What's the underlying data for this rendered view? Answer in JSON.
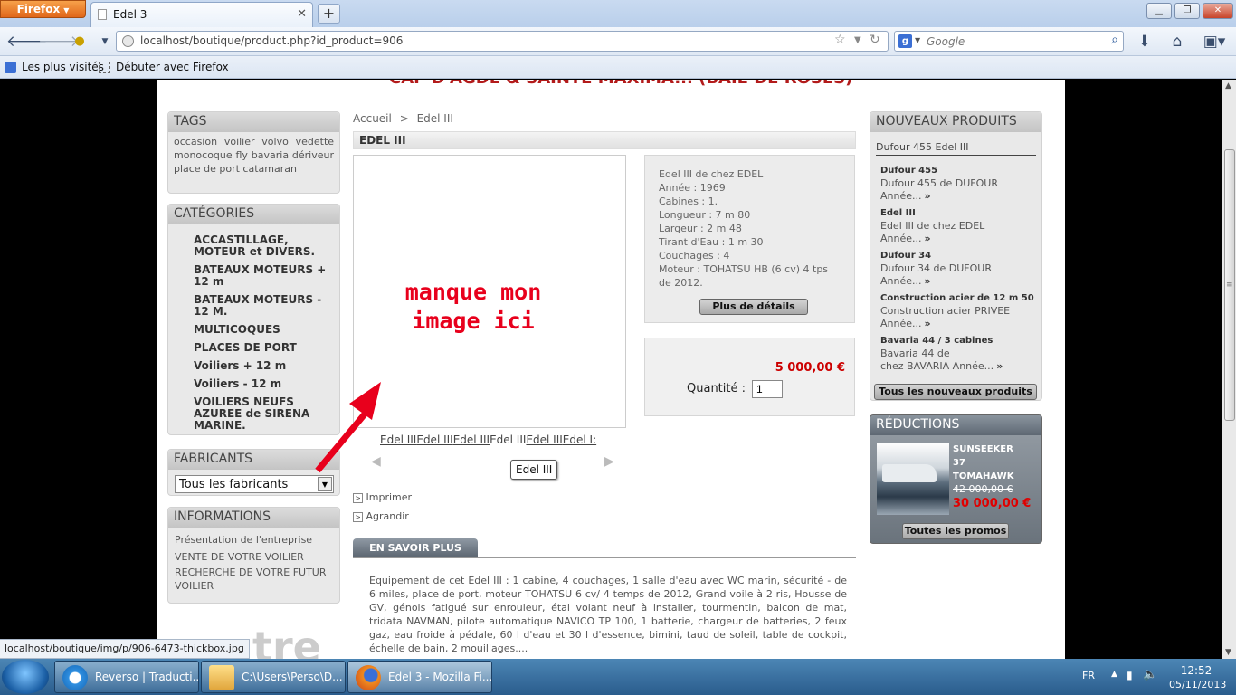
{
  "browser": {
    "app_button": "Firefox",
    "tab_title": "Edel 3",
    "url": "localhost/boutique/product.php?id_product=906",
    "search_placeholder": "Google",
    "bookmarks": [
      "Les plus visités",
      "Débuter avec Firefox"
    ],
    "status_url": "localhost/boutique/img/p/906-6473-thickbox.jpg"
  },
  "page": {
    "header_partial": "CAP D'AGDE & SAINTE MAXIMA... (BAIE DE ROSES)",
    "breadcrumb": {
      "home": "Accueil",
      "sep": ">",
      "current": "Edel III"
    },
    "product_title": "EDEL III",
    "annotation": {
      "line1": "manque mon",
      "line2": "image ici"
    },
    "thumb_links": [
      "Edel III",
      "Edel III",
      "Edel III",
      "Edel III",
      "Edel III",
      "Edel I:"
    ],
    "tooltip": "Edel III",
    "actions": {
      "print": "Imprimer",
      "zoom": "Agrandir"
    },
    "description": {
      "lines": [
        "Edel III de chez EDEL",
        "Année :  1969",
        "Cabines :  1.",
        "Longueur : 7 m 80",
        "Largeur :  2 m 48",
        "Tirant d'Eau :  1 m 30",
        "Couchages :  4",
        "Moteur : TOHATSU HB (6 cv) 4 tps",
        "de 2012."
      ],
      "details_button": "Plus de détails"
    },
    "price": "5 000,00 €",
    "quantity_label": "Quantité :",
    "quantity_value": "1",
    "more_tab": "EN SAVOIR PLUS",
    "more_text": "Equipement de cet Edel III : 1 cabine, 4 couchages, 1 salle d'eau avec WC marin, sécurité - de 6 miles, place de port, moteur TOHATSU 6 cv/ 4 temps de 2012, Grand voile à 2 ris, Housse de GV, génois fatigué sur enrouleur, étai volant neuf à installer, tourmentin, balcon de mat, tridata NAVMAN, pilote automatique NAVICO TP 100, 1 batterie, chargeur de batteries, 2 feux gaz, eau froide à pédale, 60 l d'eau et 30 l d'essence, bimini, taud de soleil, table de cockpit, échelle de bain, 2 mouillages....",
    "footer_partial": "tre"
  },
  "left": {
    "tags": {
      "title": "TAGS",
      "items": [
        "occasion",
        "voilier",
        "volvo",
        "vedette",
        "monocoque",
        "fly",
        "bavaria",
        "dériveur",
        "place",
        "de",
        "port",
        "catamaran"
      ]
    },
    "categories": {
      "title": "CATÉGORIES",
      "items": [
        "ACCASTILLAGE, MOTEUR et DIVERS.",
        "BATEAUX MOTEURS + 12 m",
        "BATEAUX MOTEURS - 12 M.",
        "MULTICOQUES",
        "PLACES DE PORT",
        "Voiliers + 12 m",
        "Voiliers - 12 m",
        "VOILIERS NEUFS AZUREE de SIRENA MARINE."
      ]
    },
    "manufacturers": {
      "title": "FABRICANTS",
      "selected": "Tous les fabricants"
    },
    "info": {
      "title": "INFORMATIONS",
      "items": [
        "Présentation de l'entreprise",
        "VENTE DE VOTRE VOILIER",
        "RECHERCHE DE VOTRE FUTUR VOILIER"
      ]
    }
  },
  "right": {
    "new_products": {
      "title": "NOUVEAUX PRODUITS",
      "top_link": "Dufour 455 Edel III",
      "items": [
        {
          "name": "Dufour 455",
          "desc": "Dufour 455 de DUFOUR",
          "more": "Année..."
        },
        {
          "name": "Edel III",
          "desc": "Edel III de chez EDEL",
          "more": "Année..."
        },
        {
          "name": "Dufour 34",
          "desc": "Dufour 34 de DUFOUR",
          "more": "Année..."
        },
        {
          "name": "Construction acier de 12 m 50",
          "desc": "Construction acier PRIVEE",
          "more": "Année..."
        },
        {
          "name": "Bavaria 44 / 3 cabines",
          "desc": "Bavaria 44 de",
          "more": "chez BAVARIA Année..."
        }
      ],
      "all_button": "Tous les nouveaux produits"
    },
    "discounts": {
      "title": "RÉDUCTIONS",
      "name_lines": [
        "SUNSEEKER",
        "37",
        "TOMAHAWK"
      ],
      "old_price": "42 000,00 €",
      "new_price": "30 000,00 €",
      "all_button": "Toutes les promos"
    }
  },
  "taskbar": {
    "buttons": [
      "Reverso | Traducti...",
      "C:\\Users\\Perso\\D...",
      "Edel 3 - Mozilla Fi..."
    ],
    "lang": "FR",
    "time": "12:52",
    "date": "05/11/2013"
  },
  "colors": {
    "price_red": "#cc0000",
    "annotation_red": "#e8001c",
    "panel_grey": "#e9e9e9"
  }
}
